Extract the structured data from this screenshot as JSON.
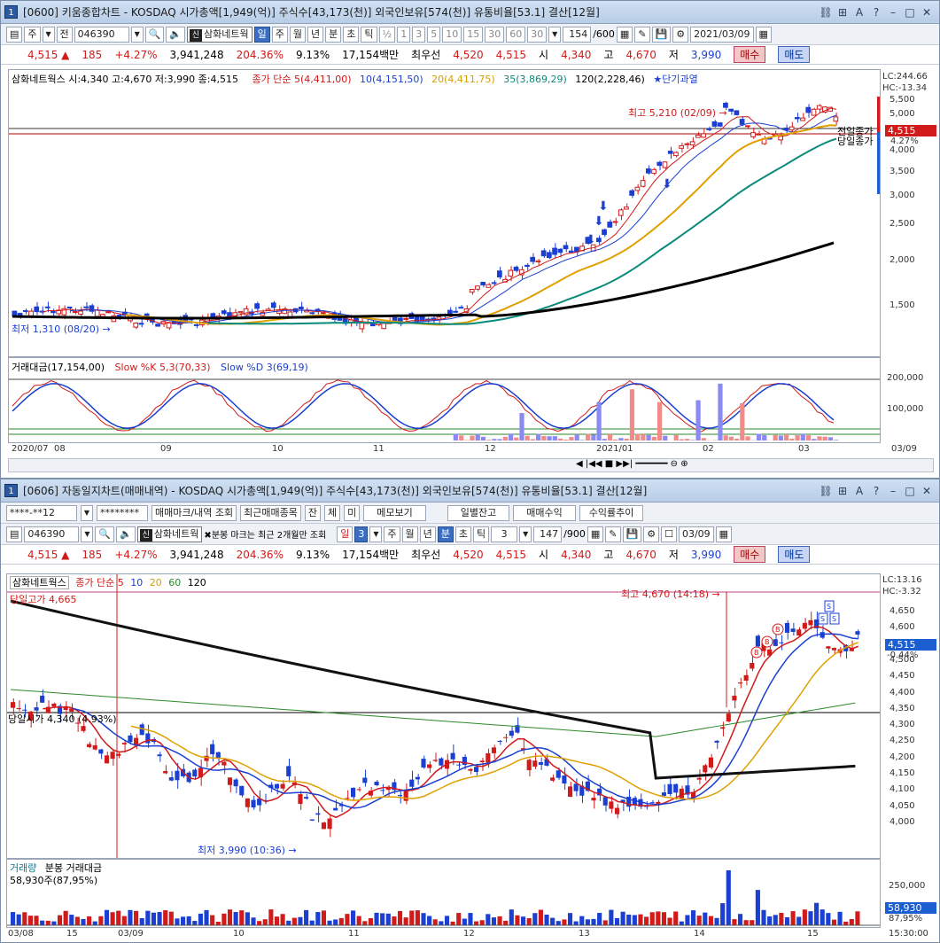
{
  "w1": {
    "title": "[0600] 키움종합차트 - KOSDAQ 시가총액[1,949(억)] 주식수[43,173(천)] 외국인보유[574(천)] 유통비율[53.1] 결산[12월]",
    "num": "1",
    "toolbar": {
      "period": "주",
      "prev": "전",
      "code": "046390",
      "name": "삼화네트웍",
      "tabs": [
        "일",
        "주",
        "월",
        "년",
        "분",
        "초",
        "틱"
      ],
      "fracs": [
        "½",
        "1",
        "3",
        "5",
        "10",
        "15",
        "30",
        "60"
      ],
      "sel_frac": "30",
      "count": "154",
      "count_max": "/600",
      "date": "2021/03/09"
    },
    "quote": {
      "price": "4,515",
      "change": "185",
      "pct": "+4.27%",
      "volume": "3,941,248",
      "vol_pct": "204.36%",
      "turn": "9.13%",
      "amount": "17,154백만",
      "best": "최우선",
      "ask": "4,520",
      "bid": "4,515",
      "open_l": "시",
      "open": "4,340",
      "high_l": "고",
      "high": "4,670",
      "low_l": "저",
      "low": "3,990",
      "buy": "매수",
      "sell": "매도"
    },
    "legend1": {
      "info": "삼화네트웍스 시:4,340 고:4,670 저:3,990 종:4,515",
      "ma_title": "종가 단순",
      "ma5": "5(4,411,00)",
      "ma10": "10(4,151,50)",
      "ma20": "20(4,411,75)",
      "ma35": "35(3,869,29)",
      "ma120": "120(2,228,46)",
      "signal": "★단기과열"
    },
    "right_top": {
      "lc": "LC:244.66",
      "hc": "HC:-13.34"
    },
    "yaxis": [
      "5,500",
      "5,000",
      "4,500",
      "4,000",
      "3,500",
      "3,000",
      "2,500",
      "2,000",
      "1,500"
    ],
    "price_badge": "4,515",
    "price_pct": "4.27%",
    "prev_close_lbl": "전일종가",
    "today_close_lbl": "당일종가",
    "high_lbl": "최고 5,210 (02/09)",
    "low_lbl": "최저 1,310 (08/20)",
    "legend2": {
      "amt": "거래대금(17,154,00)",
      "k": "Slow %K 5,3(70,33)",
      "d": "Slow %D 3(69,19)"
    },
    "yaxis2": [
      "200,000",
      "100,000"
    ],
    "xaxis": [
      "2020/07",
      "08",
      "09",
      "10",
      "11",
      "12",
      "2021/01",
      "02",
      "03",
      "03/09"
    ]
  },
  "w2": {
    "title": "[0606] 자동일지차트(매매내역) - KOSDAQ 시가총액[1,949(억)] 주식수[43,173(천)] 외국인보유[574(천)] 유통비율[53.1] 결산[12월]",
    "num": "1",
    "row1": {
      "account": "****-**12",
      "password": "********",
      "b1": "매매마크/내역 조회",
      "b2": "최근매매종목",
      "b3": "잔",
      "b4": "체",
      "b5": "미",
      "b6": "메모보기",
      "b7": "일별잔고",
      "b8": "매매수익",
      "b9": "수익률추이"
    },
    "toolbar": {
      "code": "046390",
      "name": "삼화네트웍",
      "note": "분봉 마크는 최근 2개월만 조회",
      "tabs": [
        "일",
        "주",
        "월",
        "년",
        "분",
        "초",
        "틱"
      ],
      "sel_tab": "분",
      "tick": "3",
      "day_val": "3",
      "count": "147",
      "count_max": "/900",
      "date": "03/09"
    },
    "legend": {
      "name": "삼화네트웍스",
      "ma": "종가 단순 5",
      "m10": "10",
      "m20": "20",
      "m60": "60",
      "m120": "120"
    },
    "right_top": {
      "lc": "LC:13.16",
      "hc": "HC:-3.32"
    },
    "yaxis": [
      "4,650",
      "4,600",
      "4,550",
      "4,500",
      "4,450",
      "4,400",
      "4,350",
      "4,300",
      "4,250",
      "4,200",
      "4,150",
      "4,100",
      "4,050",
      "4,000"
    ],
    "price_badge": "4,515",
    "price_pct": "-0.44%",
    "high_lbl": "최고 4,670 (14:18)",
    "low_lbl": "최저 3,990 (10:36)",
    "day_high": "당일고가 4,665",
    "day_close": "당일시가 4,340 (4.93%)",
    "vol_legend": {
      "v": "거래량",
      "amt": "분봉 거래대금",
      "val": "58,930주(87,95%)"
    },
    "yaxis2": [
      "250,000"
    ],
    "vol_badge": "58,930",
    "vol_pct": "87,95%",
    "xaxis": [
      "03/08",
      "15",
      "03/09",
      "10",
      "11",
      "12",
      "13",
      "14",
      "15",
      "15:30:00"
    ]
  }
}
